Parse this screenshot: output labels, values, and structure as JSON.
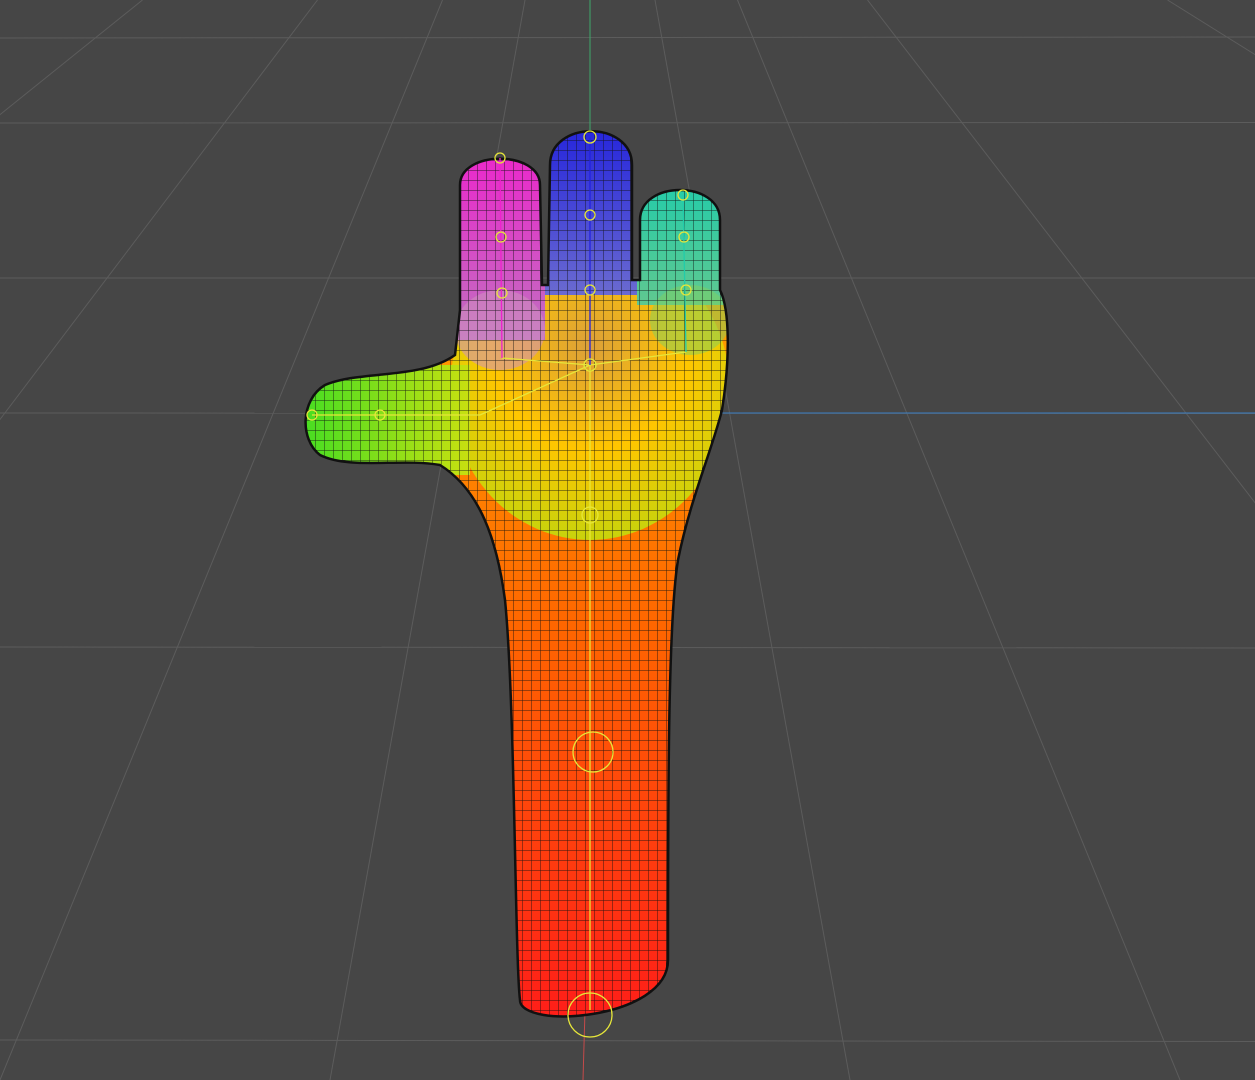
{
  "viewport": {
    "background": "#464646",
    "grid_color": "#5c5c5c",
    "axis_x_color": "#3a7fc4",
    "axis_y_color": "#3fa86a",
    "axis_z_color": "#c44a4a",
    "wire_color": "#111111",
    "joint_color": "#e6e63a"
  },
  "model": {
    "palm_color": "#ffcc00",
    "arm_top_color": "#ff9900",
    "arm_mid_color": "#ff6600",
    "arm_bottom_color": "#ff1a1a",
    "thumb_color": "#44dd22",
    "finger_left_color": "#ee22cc",
    "finger_middle_color": "#2222dd",
    "finger_right_color": "#22ccaa",
    "joints_on_arm": 3,
    "joints_per_finger": 3
  }
}
